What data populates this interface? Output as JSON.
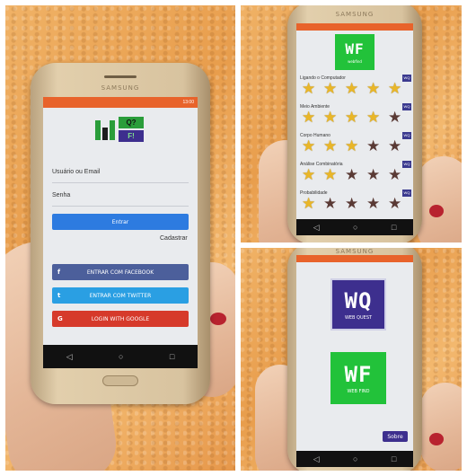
{
  "left_phone": {
    "brand": "SAMSUNG",
    "status_time": "13:00",
    "logo_cells": [
      "Q?",
      "F!"
    ],
    "username_label": "Usuário ou Email",
    "password_label": "Senha",
    "login_button": "Entrar",
    "register_link": "Cadastrar",
    "facebook_button": "ENTRAR COM FACEBOOK",
    "twitter_button": "ENTRAR COM TWITTER",
    "google_button": "LOGIN WITH GOOGLE",
    "colors": {
      "header": "#e8632b",
      "login": "#2d7be0",
      "facebook": "#4c5f9b",
      "twitter": "#2a9fe3",
      "google": "#d63a2b"
    }
  },
  "top_right_phone": {
    "brand": "SAMSUNG",
    "logo_text": "WF",
    "logo_sub": "webfind",
    "categories": [
      {
        "label": "Ligando o Computador",
        "stars": 5,
        "badge": "WQ"
      },
      {
        "label": "Meio Ambiente",
        "stars": 4,
        "badge": "WQ"
      },
      {
        "label": "Corpo Humano",
        "stars": 3,
        "badge": "WQ"
      },
      {
        "label": "Análise Combinatória",
        "stars": 2,
        "badge": "WQ"
      },
      {
        "label": "Probabilidade",
        "stars": 1,
        "badge": "WQ"
      }
    ]
  },
  "bottom_right_phone": {
    "brand": "SAMSUNG",
    "wq_title": "WQ",
    "wq_sub": "WEB QUEST",
    "wf_title": "WF",
    "wf_sub": "WEB FIND",
    "about_button": "Sobre",
    "colors": {
      "wq": "#3d2f8e",
      "wf": "#22c23a"
    }
  },
  "icons": {
    "back": "back-icon",
    "home": "home-icon",
    "recent": "recent-apps-icon"
  }
}
